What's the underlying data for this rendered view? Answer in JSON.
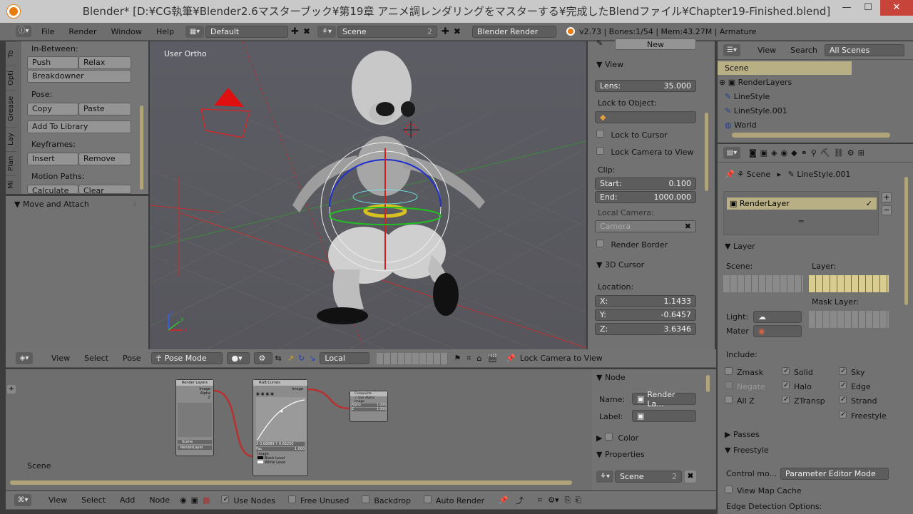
{
  "window": {
    "title": "Blender* [D:¥CG執筆¥Blender2.6マスターブック¥第19章 アニメ調レンダリングをマスターする¥完成したBlendファイル¥Chapter19-Finished.blend]",
    "min": "—",
    "max": "☐",
    "close": "✕"
  },
  "info_header": {
    "menus": [
      "File",
      "Render",
      "Window",
      "Help"
    ],
    "layout": "Default",
    "scene": "Scene",
    "scene_users": "2",
    "engine": "Blender Render",
    "stats": "v2.73 | Bones:1/54 | Mem:43.27M | Armature"
  },
  "tool_tabs": [
    "To",
    "Opti",
    "Grease",
    "Lay",
    "Plan",
    "Mi"
  ],
  "tool_panel": {
    "inbetween": "In-Between:",
    "push": "Push",
    "relax": "Relax",
    "breakdowner": "Breakdowner",
    "pose": "Pose:",
    "copy": "Copy",
    "paste": "Paste",
    "add_library": "Add To Library",
    "keyframes": "Keyframes:",
    "insert": "Insert",
    "remove": "Remove",
    "motion_paths": "Motion Paths:",
    "calculate": "Calculate",
    "clear": "Clear",
    "move_attach": "Move and Attach"
  },
  "viewport": {
    "label": "User Ortho"
  },
  "view_panel": {
    "new": "New",
    "view": "View",
    "lens_label": "Lens:",
    "lens_value": "35.000",
    "lock_to_object": "Lock to Object:",
    "lock_cursor": "Lock to Cursor",
    "lock_camera_view": "Lock Camera to View",
    "clip": "Clip:",
    "start_label": "Start:",
    "start_value": "0.100",
    "end_label": "End:",
    "end_value": "1000.000",
    "local_camera": "Local Camera:",
    "camera": "Camera",
    "render_border": "Render Border",
    "cursor3d": "3D Cursor",
    "location": "Location:",
    "x_label": "X:",
    "x_value": "1.1433",
    "y_label": "Y:",
    "y_value": "-0.6457",
    "z_label": "Z:",
    "z_value": "3.6346"
  },
  "view3d_header": {
    "view": "View",
    "select": "Select",
    "pose": "Pose",
    "mode": "Pose Mode",
    "orientation": "Local",
    "lock_camera": "Lock Camera to View"
  },
  "outliner": {
    "view": "View",
    "search": "Search",
    "filter": "All Scenes",
    "items": [
      "Scene",
      "RenderLayers",
      "LineStyle",
      "LineStyle.001",
      "World"
    ]
  },
  "properties": {
    "breadcrumb_scene": "Scene",
    "breadcrumb_style": "LineStyle.001",
    "renderlayer": "RenderLayer",
    "layer_section": "Layer",
    "scene_label": "Scene:",
    "layer_label": "Layer:",
    "mask_layer": "Mask Layer:",
    "light": "Light:",
    "mater": "Mater",
    "include": "Include:",
    "zmask": "Zmask",
    "solid": "Solid",
    "sky": "Sky",
    "negate": "Negate",
    "halo": "Halo",
    "edge": "Edge",
    "allz": "All Z",
    "ztransp": "ZTransp",
    "strand": "Strand",
    "freestyle": "Freestyle",
    "passes": "Passes",
    "freestyle_section": "Freestyle",
    "control_mode_label": "Control mo...",
    "control_mode_value": "Parameter Editor Mode",
    "view_map_cache": "View Map Cache",
    "edge_detection": "Edge Detection Options:"
  },
  "node_panel": {
    "node": "Node",
    "name_label": "Name:",
    "name_value": "Render La...",
    "label_label": "Label:",
    "color": "Color",
    "properties": "Properties",
    "scene": "Scene",
    "scene_users": "2"
  },
  "node_editor": {
    "scene_label": "Scene",
    "nodes": {
      "rl_title": "Render Layers",
      "rl_image": "Image",
      "rl_alpha": "Alpha",
      "rl_z": "Z",
      "rl_scene": "Scene",
      "rl_layer": "RenderLayer",
      "rgb_title": "RGB Curves",
      "rgb_image": "Image",
      "rgb_fac": "Fac",
      "rgb_fac_val": "1.000",
      "rgb_xy": "X 0.68889  Y 0.66250",
      "rgb_image_in": "Image",
      "rgb_black": "Black Level",
      "rgb_white": "White Level",
      "comp_title": "Composite",
      "comp_use_alpha": "Use Alpha",
      "comp_image": "Image",
      "comp_alpha": "Alpha",
      "comp_alpha_val": "1.000",
      "comp_z": "Z",
      "comp_z_val": "1.000"
    }
  },
  "node_header": {
    "view": "View",
    "select": "Select",
    "add": "Add",
    "node": "Node",
    "use_nodes": "Use Nodes",
    "free_unused": "Free Unused",
    "backdrop": "Backdrop",
    "auto_render": "Auto Render"
  }
}
